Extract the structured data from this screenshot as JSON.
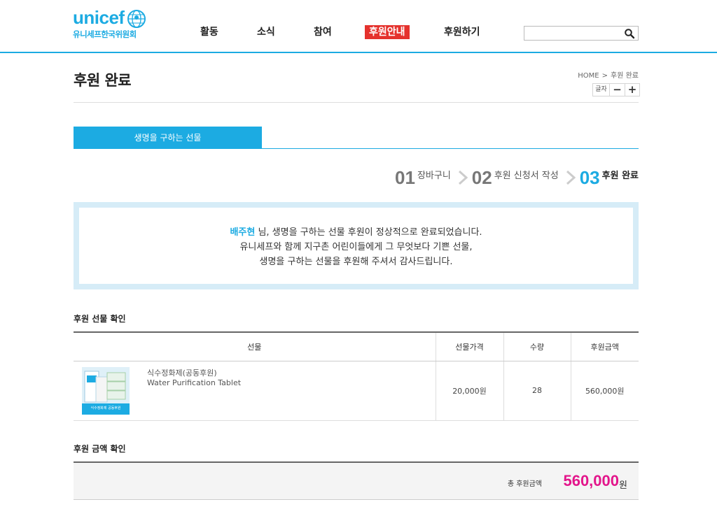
{
  "header": {
    "logo_text": "unicef",
    "logo_sub": "유니세프한국위원회",
    "nav": [
      {
        "label": "활동"
      },
      {
        "label": "소식"
      },
      {
        "label": "참여"
      },
      {
        "label": "후원안내",
        "active": true
      },
      {
        "label": "후원하기"
      }
    ],
    "search": {
      "value": "",
      "placeholder": ""
    }
  },
  "page": {
    "title": "후원 완료",
    "breadcrumb": [
      "HOME",
      "후원 완료"
    ],
    "font_size_label": "글자",
    "font_minus": "−",
    "font_plus": "+"
  },
  "tab": {
    "label": "생명을 구하는 선물"
  },
  "steps": [
    {
      "num": "01",
      "label": "장바구니"
    },
    {
      "num": "02",
      "label": "후원 신청서 작성"
    },
    {
      "num": "03",
      "label": "후원 완료",
      "active": true
    }
  ],
  "message": {
    "name": "배주현",
    "line1_rest": " 님, 생명을 구하는 선물 후원이 정상적으로 완료되었습니다.",
    "line2": "유니세프와 함께 지구촌 어린이들에게 그 무엇보다 기쁜 선물,",
    "line3": "생명을 구하는 선물을 후원해 주셔서 감사드립니다."
  },
  "gift_section": {
    "title": "후원 선물 확인",
    "columns": [
      "선물",
      "선물가격",
      "수량",
      "후원금액"
    ],
    "rows": [
      {
        "name_ko": "식수정화제(공동후원)",
        "name_en": "Water Purification Tablet",
        "thumb_caption": "식수정화제 공동후원",
        "price": "20,000원",
        "qty": "28",
        "amount": "560,000원"
      }
    ]
  },
  "total_section": {
    "title": "후원 금액 확인",
    "label": "총 후원금액",
    "value": "560,000",
    "unit": "원"
  },
  "colors": {
    "brand": "#1cabe2",
    "active_nav": "#e5322d",
    "total": "#e3158b"
  }
}
